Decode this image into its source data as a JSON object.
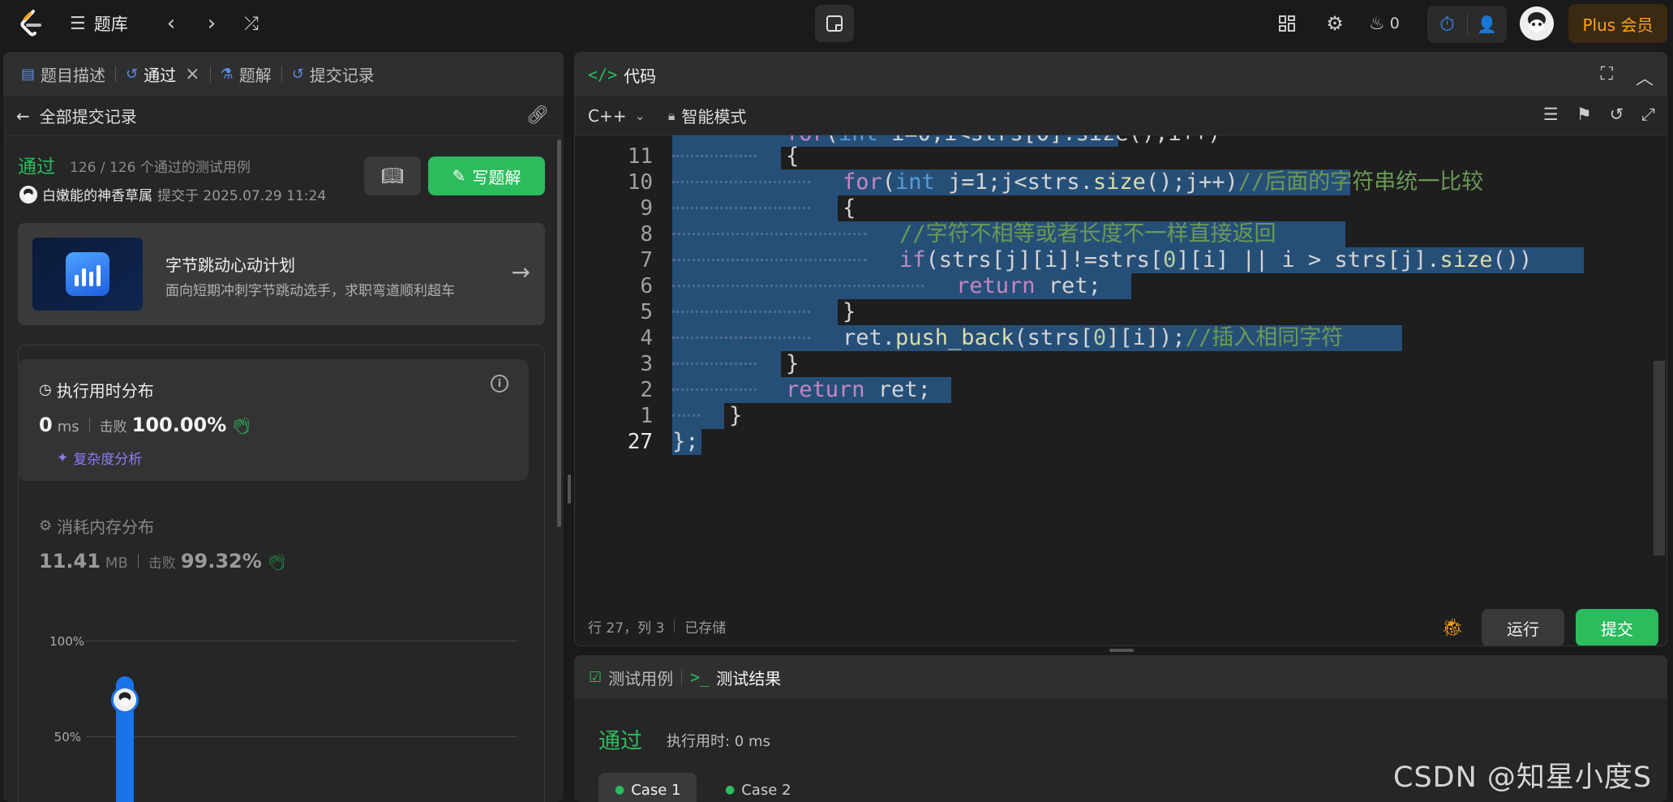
{
  "topbar": {
    "problem_bank": "题库",
    "fire_count": "0",
    "plus": "Plus 会员"
  },
  "left": {
    "tabs": [
      {
        "label": "题目描述"
      },
      {
        "label": "通过"
      },
      {
        "label": "题解"
      },
      {
        "label": "提交记录"
      }
    ],
    "back_label": "全部提交记录",
    "status": "通过",
    "count": "126 / 126 个通过的测试用例",
    "author": "白嫩能的神香草属",
    "submitted": "提交于 2025.07.29 11:24",
    "write_solution": "写题解",
    "promo": {
      "title": "字节跳动心动计划",
      "subtitle": "面向短期冲刺字节跳动选手，求职弯道顺利超车"
    },
    "runtime": {
      "title": "执行用时分布",
      "value": "0",
      "unit": "ms",
      "beat_label": "击败",
      "beat": "100.00%",
      "complexity": "复杂度分析"
    },
    "memory": {
      "title": "消耗内存分布",
      "value": "11.41",
      "unit": "MB",
      "beat_label": "击败",
      "beat": "99.32%"
    },
    "chart": {
      "y_ticks": [
        "100%",
        "50%"
      ]
    }
  },
  "code": {
    "title": "代码",
    "language": "C++",
    "mode": "智能模式",
    "footer_pos": "行 27，列 3",
    "footer_saved": "已存储",
    "run": "运行",
    "submit": "提交",
    "line_numbers": [
      "11",
      "10",
      "9",
      "8",
      "7",
      "6",
      "5",
      "4",
      "3",
      "2",
      "1",
      "27"
    ]
  },
  "result": {
    "tab_cases": "测试用例",
    "tab_result": "测试结果",
    "status": "通过",
    "runtime": "执行用时: 0 ms",
    "cases": [
      "Case 1",
      "Case 2"
    ]
  },
  "watermark": "CSDN @知星小度S"
}
